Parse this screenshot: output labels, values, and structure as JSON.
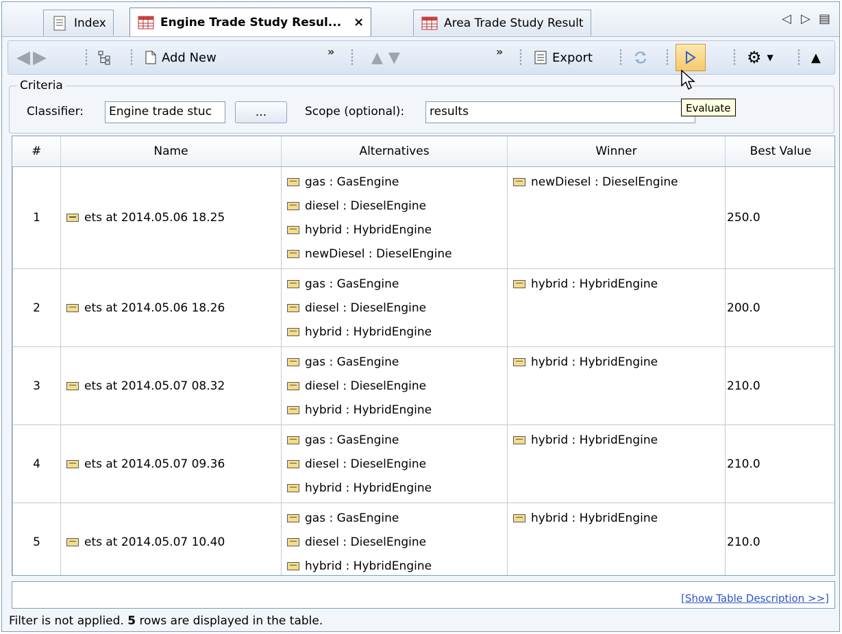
{
  "tabs": [
    {
      "label": "Index",
      "icon": "document-icon"
    },
    {
      "label": "Engine Trade Study Resul...",
      "icon": "table-icon",
      "close": "×"
    },
    {
      "label": "Area Trade Study Result",
      "icon": "table-icon"
    }
  ],
  "toolbar": {
    "add_new_label": "Add New",
    "export_label": "Export",
    "overflow_chevron": "»"
  },
  "criteria": {
    "legend": "Criteria",
    "classifier_label": "Classifier:",
    "classifier_value": "Engine trade stuc",
    "browse_label": "...",
    "scope_label": "Scope (optional):",
    "scope_value": "results"
  },
  "tooltip": "Evaluate",
  "table": {
    "columns": [
      "#",
      "Name",
      "Alternatives",
      "Winner",
      "Best Value"
    ],
    "rows": [
      {
        "num": "1",
        "name": "ets at 2014.05.06 18.25",
        "alternatives": [
          "gas : GasEngine",
          "diesel : DieselEngine",
          "hybrid : HybridEngine",
          "newDiesel : DieselEngine"
        ],
        "winner": "newDiesel : DieselEngine",
        "best": "250.0"
      },
      {
        "num": "2",
        "name": "ets at 2014.05.06 18.26",
        "alternatives": [
          "gas : GasEngine",
          "diesel : DieselEngine",
          "hybrid : HybridEngine"
        ],
        "winner": "hybrid : HybridEngine",
        "best": "200.0"
      },
      {
        "num": "3",
        "name": "ets at 2014.05.07 08.32",
        "alternatives": [
          "gas : GasEngine",
          "diesel : DieselEngine",
          "hybrid : HybridEngine"
        ],
        "winner": "hybrid : HybridEngine",
        "best": "210.0"
      },
      {
        "num": "4",
        "name": "ets at 2014.05.07 09.36",
        "alternatives": [
          "gas : GasEngine",
          "diesel : DieselEngine",
          "hybrid : HybridEngine"
        ],
        "winner": "hybrid : HybridEngine",
        "best": "210.0"
      },
      {
        "num": "5",
        "name": "ets at 2014.05.07 10.40",
        "alternatives": [
          "gas : GasEngine",
          "diesel : DieselEngine",
          "hybrid : HybridEngine"
        ],
        "winner": "hybrid : HybridEngine",
        "best": "210.0"
      }
    ]
  },
  "description_link": "[Show Table Description >>]",
  "status": {
    "prefix": "Filter is not applied.",
    "count": "5",
    "suffix": "rows are displayed in the table."
  },
  "colors": {
    "link": "#2a54c6",
    "evaluate_highlight": "#f7c96b",
    "instance_icon": "#f3dc86"
  }
}
